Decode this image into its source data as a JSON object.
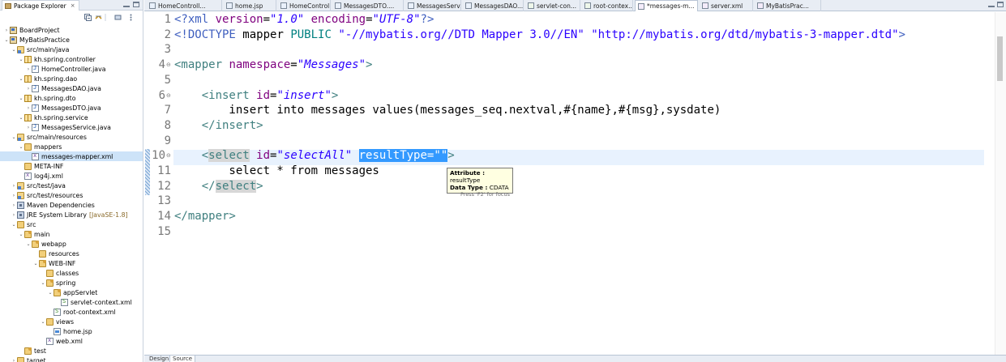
{
  "explorer": {
    "title": "Package Explorer",
    "tree": [
      {
        "label": "BoardProject",
        "icon": "project-icon",
        "twisty": "closed",
        "depth": 0
      },
      {
        "label": "MyBatisPractice",
        "icon": "project-icon",
        "twisty": "open",
        "depth": 0
      },
      {
        "label": "src/main/java",
        "icon": "source-folder-icon",
        "twisty": "open",
        "depth": 1
      },
      {
        "label": "kh.spring.controller",
        "icon": "package-icon",
        "twisty": "open",
        "depth": 2
      },
      {
        "label": "HomeController.java",
        "icon": "java-file-icon",
        "twisty": "closed",
        "depth": 3
      },
      {
        "label": "kh.spring.dao",
        "icon": "package-icon",
        "twisty": "open",
        "depth": 2
      },
      {
        "label": "MessagesDAO.java",
        "icon": "java-file-icon",
        "twisty": "closed",
        "depth": 3
      },
      {
        "label": "kh.spring.dto",
        "icon": "package-icon",
        "twisty": "open",
        "depth": 2
      },
      {
        "label": "MessagesDTO.java",
        "icon": "java-file-icon",
        "twisty": "closed",
        "depth": 3
      },
      {
        "label": "kh.spring.service",
        "icon": "package-icon",
        "twisty": "open",
        "depth": 2
      },
      {
        "label": "MessagesService.java",
        "icon": "java-file-icon",
        "twisty": "closed",
        "depth": 3
      },
      {
        "label": "src/main/resources",
        "icon": "source-folder-icon",
        "twisty": "open",
        "depth": 1
      },
      {
        "label": "mappers",
        "icon": "folder-icon",
        "twisty": "open",
        "depth": 2
      },
      {
        "label": "messages-mapper.xml",
        "icon": "xml-file-icon",
        "twisty": "none",
        "depth": 3,
        "selected": true
      },
      {
        "label": "META-INF",
        "icon": "folder-icon",
        "twisty": "none",
        "depth": 2
      },
      {
        "label": "log4j.xml",
        "icon": "xml-file-icon",
        "twisty": "none",
        "depth": 2
      },
      {
        "label": "src/test/java",
        "icon": "source-folder-icon",
        "twisty": "closed",
        "depth": 1
      },
      {
        "label": "src/test/resources",
        "icon": "source-folder-icon",
        "twisty": "closed",
        "depth": 1
      },
      {
        "label": "Maven Dependencies",
        "icon": "library-icon",
        "twisty": "closed",
        "depth": 1
      },
      {
        "label": "JRE System Library",
        "decoration": "[JavaSE-1.8]",
        "icon": "library-icon",
        "twisty": "closed",
        "depth": 1
      },
      {
        "label": "src",
        "icon": "folder-icon",
        "twisty": "open",
        "depth": 1
      },
      {
        "label": "main",
        "icon": "web-folder-icon",
        "twisty": "open",
        "depth": 2
      },
      {
        "label": "webapp",
        "icon": "web-folder-icon",
        "twisty": "open",
        "depth": 3
      },
      {
        "label": "resources",
        "icon": "folder-icon",
        "twisty": "none",
        "depth": 4
      },
      {
        "label": "WEB-INF",
        "icon": "web-folder-icon",
        "twisty": "open",
        "depth": 4
      },
      {
        "label": "classes",
        "icon": "folder-icon",
        "twisty": "none",
        "depth": 5
      },
      {
        "label": "spring",
        "icon": "web-folder-icon",
        "twisty": "open",
        "depth": 5
      },
      {
        "label": "appServlet",
        "icon": "web-folder-icon",
        "twisty": "open",
        "depth": 6
      },
      {
        "label": "servlet-context.xml",
        "icon": "spring-beans-icon",
        "twisty": "none",
        "depth": 7
      },
      {
        "label": "root-context.xml",
        "icon": "spring-beans-icon",
        "twisty": "none",
        "depth": 6
      },
      {
        "label": "views",
        "icon": "folder-icon",
        "twisty": "open",
        "depth": 5
      },
      {
        "label": "home.jsp",
        "icon": "jsp-file-icon",
        "twisty": "none",
        "depth": 6
      },
      {
        "label": "web.xml",
        "icon": "xml-file-icon",
        "twisty": "none",
        "depth": 5
      },
      {
        "label": "test",
        "icon": "web-folder-icon",
        "twisty": "none",
        "depth": 2
      },
      {
        "label": "target",
        "icon": "folder-icon",
        "twisty": "closed",
        "depth": 1
      }
    ]
  },
  "editor_tabs": [
    {
      "label": "HomeControll...",
      "icon": "java-file-icon",
      "kind": "j",
      "active": false
    },
    {
      "label": "home.jsp",
      "icon": "jsp-file-icon",
      "kind": "j",
      "active": false
    },
    {
      "label": "HomeControll...",
      "icon": "java-file-icon",
      "kind": "j",
      "active": false
    },
    {
      "label": "MessagesDTO....",
      "icon": "java-file-icon",
      "kind": "j",
      "active": false
    },
    {
      "label": "MessagesServ...",
      "icon": "java-file-icon",
      "kind": "j",
      "active": false
    },
    {
      "label": "MessagesDAO....",
      "icon": "java-file-icon",
      "kind": "j",
      "active": false
    },
    {
      "label": "servlet-con...",
      "icon": "spring-beans-icon",
      "kind": "s",
      "active": false
    },
    {
      "label": "root-contex...",
      "icon": "spring-beans-icon",
      "kind": "s",
      "active": false
    },
    {
      "label": "*messages-m...",
      "icon": "xml-file-icon",
      "kind": "x",
      "active": true
    },
    {
      "label": "server.xml",
      "icon": "xml-file-icon",
      "kind": "x",
      "active": false
    },
    {
      "label": "MyBatisPrac...",
      "icon": "xml-file-icon",
      "kind": "x",
      "active": false
    }
  ],
  "tab_overflow": "»",
  "code": {
    "line_numbers": [
      "1",
      "2",
      "3",
      "4",
      "5",
      "6",
      "7",
      "8",
      "9",
      "10",
      "11",
      "12",
      "13",
      "14",
      "15"
    ],
    "folded_lines": [
      4,
      6,
      10
    ],
    "current_line": 10
  },
  "tooltip": {
    "attribute_label": "Attribute :",
    "attribute_value": "resultType",
    "datatype_label": "Data Type :",
    "datatype_value": "CDATA",
    "hint": "Press 'F2' for focus"
  },
  "bottom_tabs": [
    "Design",
    "Source"
  ],
  "colors": {
    "tag": "#3f7f7f",
    "attribute": "#7f007f",
    "value": "#2a00ff",
    "selection": "#3399ff",
    "current_line": "#e8f2fe"
  }
}
